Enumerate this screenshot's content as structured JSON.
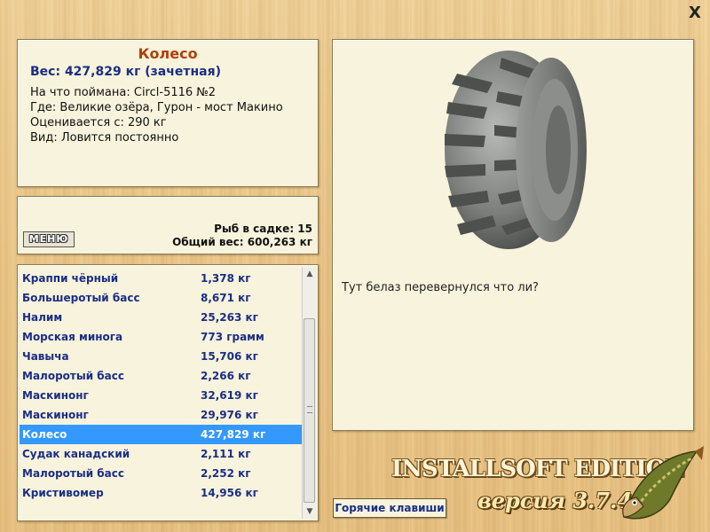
{
  "window": {
    "close_label": "X"
  },
  "info": {
    "fish_name": "Колесо",
    "weight_line": "Вес: 427,829 кг (зачетная)",
    "caught_on": "На что поймана: Circl-5116 №2",
    "location": "Где: Великие озёра, Гурон - мост Макино",
    "valued_from": "Оценивается с: 290 кг",
    "type": "Вид: Ловится постоянно"
  },
  "summary": {
    "menu_label": "МЕНЮ",
    "fish_count": "Рыб в садке: 15",
    "total_weight": "Общий вес: 600,263 кг"
  },
  "fish_list": [
    {
      "name": "Краппи чёрный",
      "weight": "1,378 кг"
    },
    {
      "name": "Большеротый басс",
      "weight": "8,671 кг"
    },
    {
      "name": "Налим",
      "weight": "25,263 кг"
    },
    {
      "name": "Морская минога",
      "weight": "773 грамм"
    },
    {
      "name": "Чавыча",
      "weight": "15,706 кг"
    },
    {
      "name": "Малоротый басс",
      "weight": "2,266 кг"
    },
    {
      "name": "Маскинонг",
      "weight": "32,619 кг"
    },
    {
      "name": "Маскинонг",
      "weight": "29,976 кг"
    },
    {
      "name": "Колесо",
      "weight": "427,829 кг",
      "selected": true
    },
    {
      "name": "Судак канадский",
      "weight": "2,111 кг"
    },
    {
      "name": "Малоротый басс",
      "weight": "2,252 кг"
    },
    {
      "name": "Кристивомер",
      "weight": "14,956 кг"
    }
  ],
  "image_panel": {
    "comment": "Тут белаз перевернулся что ли?",
    "image_icon": "tyre-image"
  },
  "hotkeys_label": "Горячие клавиши",
  "brand": {
    "title": "INSTALLSOFT EDITION",
    "version": "версия 3.7.4",
    "logo_icon": "pike-fish-icon"
  },
  "colors": {
    "accent_title": "#b0400a",
    "list_text": "#1a2e86",
    "selection": "#3399ff"
  }
}
